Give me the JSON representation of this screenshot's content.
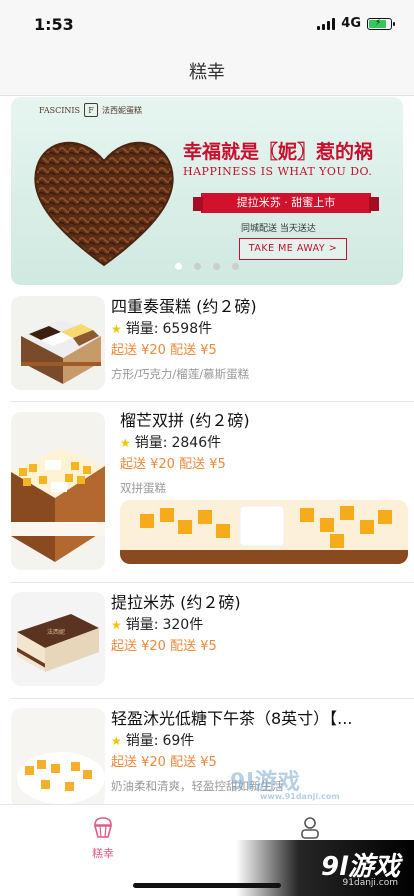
{
  "status": {
    "time": "1:53",
    "network": "4G"
  },
  "nav": {
    "title": "糕幸"
  },
  "banner": {
    "brand_name": "FASCINIS",
    "brand_mark": "F",
    "brand_cn": "法西妮蛋糕",
    "headline": "幸福就是〖妮〗惹的祸",
    "headline_en": "HAPPINESS IS WHAT YOU DO.",
    "ribbon": "提拉米苏 · 甜蜜上市",
    "sub": "同城配送 当天送达",
    "button": "TAKE ME AWAY >",
    "pages": 4,
    "active_page": 1
  },
  "products": [
    {
      "name": "四重奏蛋糕 (约２磅)",
      "sales_label": "销量:",
      "sales": "6598件",
      "price": "起送 ¥20 配送 ¥5",
      "tags": "方形/巧克力/榴莲/慕斯蛋糕"
    },
    {
      "name": "榴芒双拼 (约２磅)",
      "sales_label": "销量:",
      "sales": "2846件",
      "price": "起送 ¥20 配送 ¥5",
      "tags": "双拼蛋糕"
    },
    {
      "name": "提拉米苏 (约２磅)",
      "sales_label": "销量:",
      "sales": "320件",
      "price": "起送 ¥20 配送 ¥5",
      "tags": ""
    },
    {
      "name": "轻盈沐光低糖下午茶（8英寸）【...",
      "sales_label": "销量:",
      "sales": "69件",
      "price": "起送 ¥20 配送 ¥5",
      "tags": "奶油柔和清爽，轻盈控甜如新生活"
    }
  ],
  "tabs": [
    {
      "label": "糕幸",
      "icon": "cupcake-icon",
      "active": true
    },
    {
      "label": "",
      "icon": "user-icon",
      "active": false
    }
  ],
  "watermark": {
    "text1": "9l游戏",
    "text1_url": "www.91danji.com",
    "text2": "9l游戏",
    "text2_url": "91danji.com"
  },
  "colors": {
    "accent": "#e25b84",
    "price": "#f0883a",
    "banner_red": "#c8102e",
    "star": "#f5c400"
  }
}
